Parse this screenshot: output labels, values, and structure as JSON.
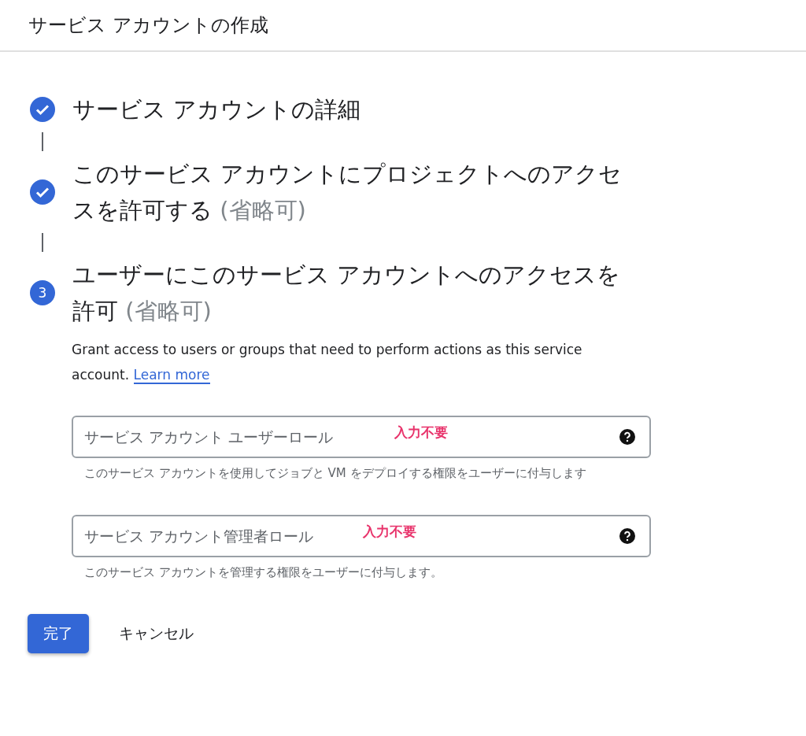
{
  "header": {
    "title": "サービス アカウントの作成"
  },
  "steps": [
    {
      "kind": "done",
      "title": "サービス アカウントの詳細"
    },
    {
      "kind": "done",
      "title": "このサービス アカウントにプロジェクトへのアクセスを許可する",
      "optional": "(省略可)"
    },
    {
      "kind": "current",
      "number": "3",
      "title": "ユーザーにこのサービス アカウントへのアクセスを許可",
      "optional": "(省略可)"
    }
  ],
  "description": {
    "text": "Grant access to users or groups that need to perform actions as this service account.",
    "link": "Learn more"
  },
  "fields": [
    {
      "placeholder": "サービス アカウント ユーザーロール",
      "annotation": "入力不要",
      "helper": "このサービス アカウントを使用してジョブと VM をデプロイする権限をユーザーに付与します"
    },
    {
      "placeholder": "サービス アカウント管理者ロール",
      "annotation": "入力不要",
      "helper": "このサービス アカウントを管理する権限をユーザーに付与します。"
    }
  ],
  "buttons": [
    {
      "kind": "primary",
      "label": "完了"
    },
    {
      "kind": "text",
      "label": "キャンセル"
    }
  ]
}
